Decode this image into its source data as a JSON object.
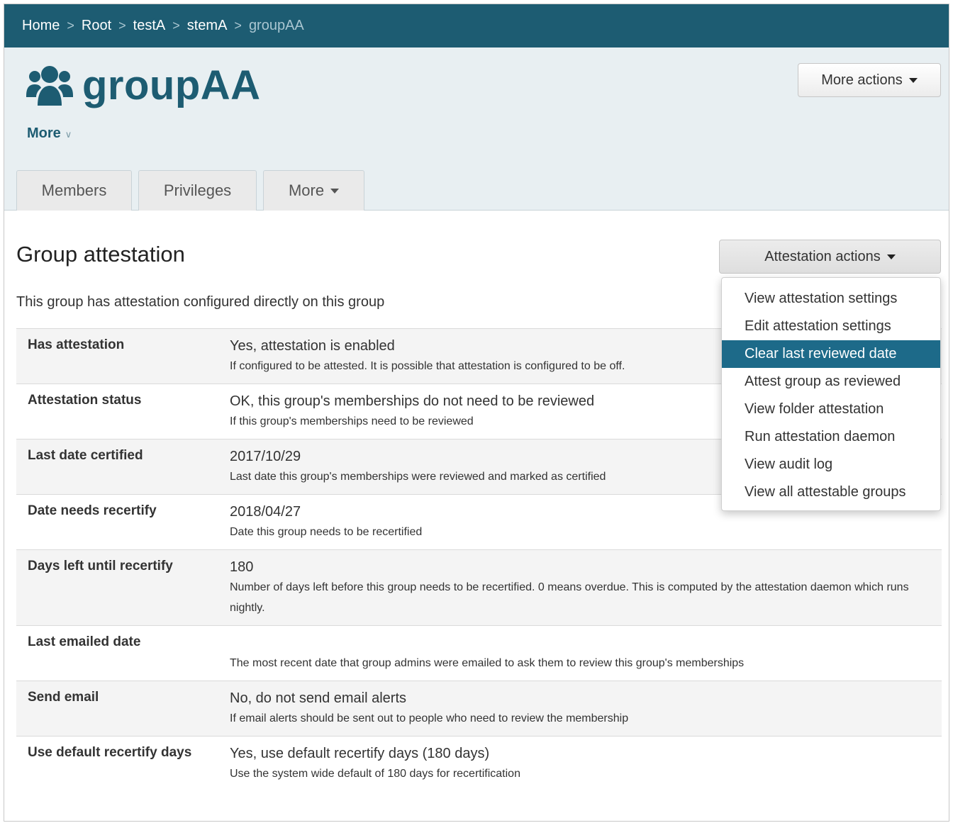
{
  "breadcrumb": {
    "items": [
      "Home",
      "Root",
      "testA",
      "stemA"
    ],
    "current": "groupAA",
    "separator": ">"
  },
  "header": {
    "title": "groupAA",
    "icon": "users-group-icon",
    "more_label": "More",
    "more_actions_label": "More actions"
  },
  "tabs": [
    {
      "label": "Members"
    },
    {
      "label": "Privileges"
    },
    {
      "label": "More"
    }
  ],
  "main": {
    "section_title": "Group attestation",
    "attestation_actions_label": "Attestation actions",
    "intro": "This group has attestation configured directly on this group",
    "rows": [
      {
        "label": "Has attestation",
        "value": "Yes, attestation is enabled",
        "description": "If configured to be attested. It is possible that attestation is configured to be off."
      },
      {
        "label": "Attestation status",
        "value": "OK, this group's memberships do not need to be reviewed",
        "description": "If this group's memberships need to be reviewed"
      },
      {
        "label": "Last date certified",
        "value": "2017/10/29",
        "description": "Last date this group's memberships were reviewed and marked as certified"
      },
      {
        "label": "Date needs recertify",
        "value": "2018/04/27",
        "description": "Date this group needs to be recertified"
      },
      {
        "label": "Days left until recertify",
        "value": "180",
        "description": "Number of days left before this group needs to be recertified. 0 means overdue. This is computed by the attestation daemon which runs nightly."
      },
      {
        "label": "Last emailed date",
        "value": "",
        "description": "The most recent date that group admins were emailed to ask them to review this group's memberships"
      },
      {
        "label": "Send email",
        "value": "No, do not send email alerts",
        "description": "If email alerts should be sent out to people who need to review the membership"
      },
      {
        "label": "Use default recertify days",
        "value": "Yes, use default recertify days (180 days)",
        "description": "Use the system wide default of 180 days for recertification"
      }
    ]
  },
  "dropdown": {
    "items": [
      "View attestation settings",
      "Edit attestation settings",
      "Clear last reviewed date",
      "Attest group as reviewed",
      "View folder attestation",
      "Run attestation daemon",
      "View audit log",
      "View all attestable groups"
    ],
    "active_index": 2
  },
  "colors": {
    "brand": "#1d5c72",
    "header_bg": "#e8eff2",
    "active_item": "#1d6a89"
  }
}
